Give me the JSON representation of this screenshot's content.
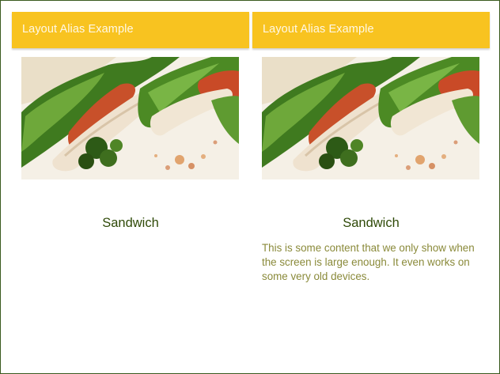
{
  "screens": {
    "left": {
      "toolbar_title": "Layout Alias Example",
      "product_name": "Sandwich",
      "image": "sandwich-photo"
    },
    "right": {
      "toolbar_title": "Layout Alias Example",
      "product_name": "Sandwich",
      "image": "sandwich-photo",
      "description": "This is some content that we only show when the screen is large enough. It even works on some very old devices."
    }
  },
  "colors": {
    "toolbar": "#f8c320",
    "toolbar_text": "#fff8e6",
    "product_name": "#2f4a08",
    "description": "#8a8a3a",
    "frame_border": "#3a5a1e"
  }
}
